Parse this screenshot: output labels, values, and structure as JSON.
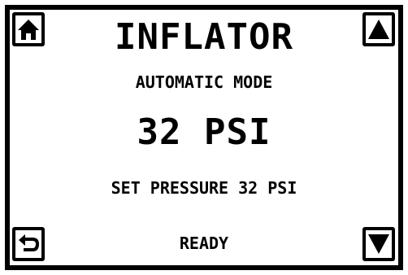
{
  "screen": {
    "title": "INFLATOR",
    "mode": "AUTOMATIC MODE",
    "current_pressure": "32 PSI",
    "set_pressure": "SET PRESSURE 32 PSI",
    "status": "READY"
  },
  "buttons": {
    "home": {
      "icon": "home-icon"
    },
    "up": {
      "icon": "arrow-up-icon"
    },
    "back": {
      "icon": "back-arrow-icon"
    },
    "down": {
      "icon": "arrow-down-icon"
    }
  },
  "colors": {
    "foreground": "#000000",
    "background": "#ffffff"
  }
}
